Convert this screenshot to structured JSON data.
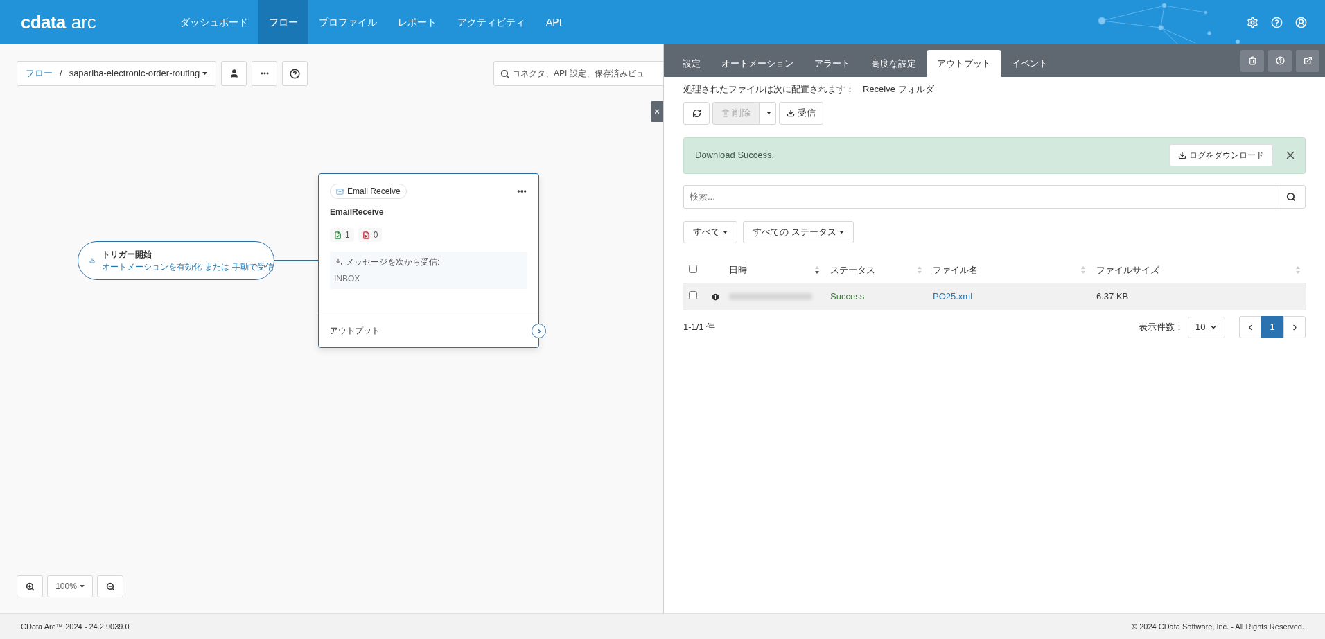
{
  "header": {
    "logo": {
      "brand": "cdata",
      "product": "arc"
    },
    "nav": [
      {
        "label": "ダッシュボード",
        "selected": false
      },
      {
        "label": "フロー",
        "selected": true
      },
      {
        "label": "プロファイル",
        "selected": false
      },
      {
        "label": "レポート",
        "selected": false
      },
      {
        "label": "アクティビティ",
        "selected": false
      },
      {
        "label": "API",
        "selected": false
      }
    ]
  },
  "canvas": {
    "breadcrumb": {
      "root": "フロー",
      "separator": "/",
      "current": "sapariba-electronic-order-routing"
    },
    "search": {
      "placeholder": "コネクタ、API 設定、保存済みビュ"
    },
    "close_label": "×",
    "trigger": {
      "title": "トリガー開始",
      "link_1": "オートメーションを有効化",
      "conjunction": "または",
      "link_2": "手動で受信"
    },
    "connector": {
      "badge": "Email Receive",
      "name": "EmailReceive",
      "success_count": "1",
      "error_count": "0",
      "receive_label": "メッセージを次から受信:",
      "folder": "INBOX",
      "output_label": "アウトプット"
    },
    "zoom": {
      "level": "100%"
    }
  },
  "panel": {
    "tabs": [
      {
        "label": "設定",
        "selected": false
      },
      {
        "label": "オートメーション",
        "selected": false
      },
      {
        "label": "アラート",
        "selected": false
      },
      {
        "label": "高度な設定",
        "selected": false
      },
      {
        "label": "アウトプット",
        "selected": true
      },
      {
        "label": "イベント",
        "selected": false
      }
    ],
    "location": {
      "label": "処理されたファイルは次に配置されます：",
      "value": "Receive フォルダ"
    },
    "toolbar": {
      "delete_label": "削除",
      "delete_disabled": true,
      "receive_label": "受信"
    },
    "alert": {
      "message": "Download Success.",
      "button": "ログをダウンロード"
    },
    "search": {
      "placeholder": "検索..."
    },
    "filters": [
      "すべて",
      "すべての ステータス"
    ],
    "table": {
      "header_checked": false,
      "columns": [
        {
          "label": "日時",
          "sorted": true
        },
        {
          "label": "ステータス",
          "sorted": false
        },
        {
          "label": "ファイル名",
          "sorted": false
        },
        {
          "label": "ファイルサイズ",
          "sorted": false
        }
      ],
      "rows": [
        {
          "checked": false,
          "status": "Success",
          "file": "PO25.xml",
          "size": "6.37 KB"
        }
      ]
    },
    "summary": "1-1/1 件",
    "page_size_label": "表示件数：",
    "page_size": "10",
    "pages": [
      {
        "label": "1",
        "selected": true
      }
    ]
  },
  "footer": {
    "version": "CData Arc™ 2024 - 24.2.9039.0",
    "copyright": "© 2024 CData Software, Inc. - All Rights Reserved."
  }
}
